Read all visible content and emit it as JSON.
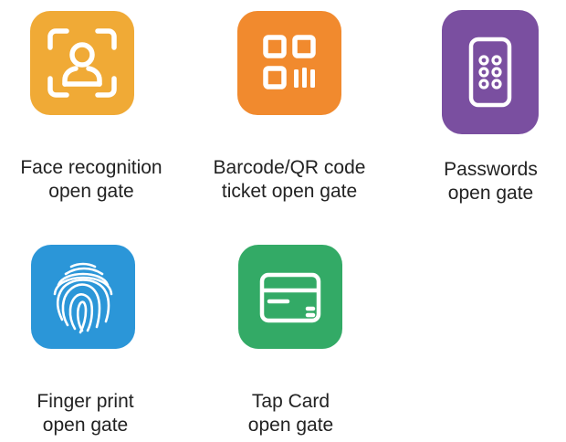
{
  "colors": {
    "face": "#F0AA36",
    "barcode": "#F18A2E",
    "passwords": "#7A4FA0",
    "fingerprint": "#2B96D8",
    "tapcard": "#33AA66",
    "icon_stroke": "#FFFFFF",
    "text": "#222222"
  },
  "methods": [
    {
      "id": "face",
      "icon": "face-frame-icon",
      "line1": "Face recognition",
      "line2": "open gate"
    },
    {
      "id": "barcode",
      "icon": "qr-code-icon",
      "line1": "Barcode/QR code",
      "line2": "ticket open gate"
    },
    {
      "id": "passwords",
      "icon": "keypad-icon",
      "line1": "Passwords",
      "line2": "open gate"
    },
    {
      "id": "fingerprint",
      "icon": "fingerprint-icon",
      "line1": "Finger print",
      "line2": "open gate"
    },
    {
      "id": "tapcard",
      "icon": "card-icon",
      "line1": "Tap Card",
      "line2": "open gate"
    }
  ]
}
